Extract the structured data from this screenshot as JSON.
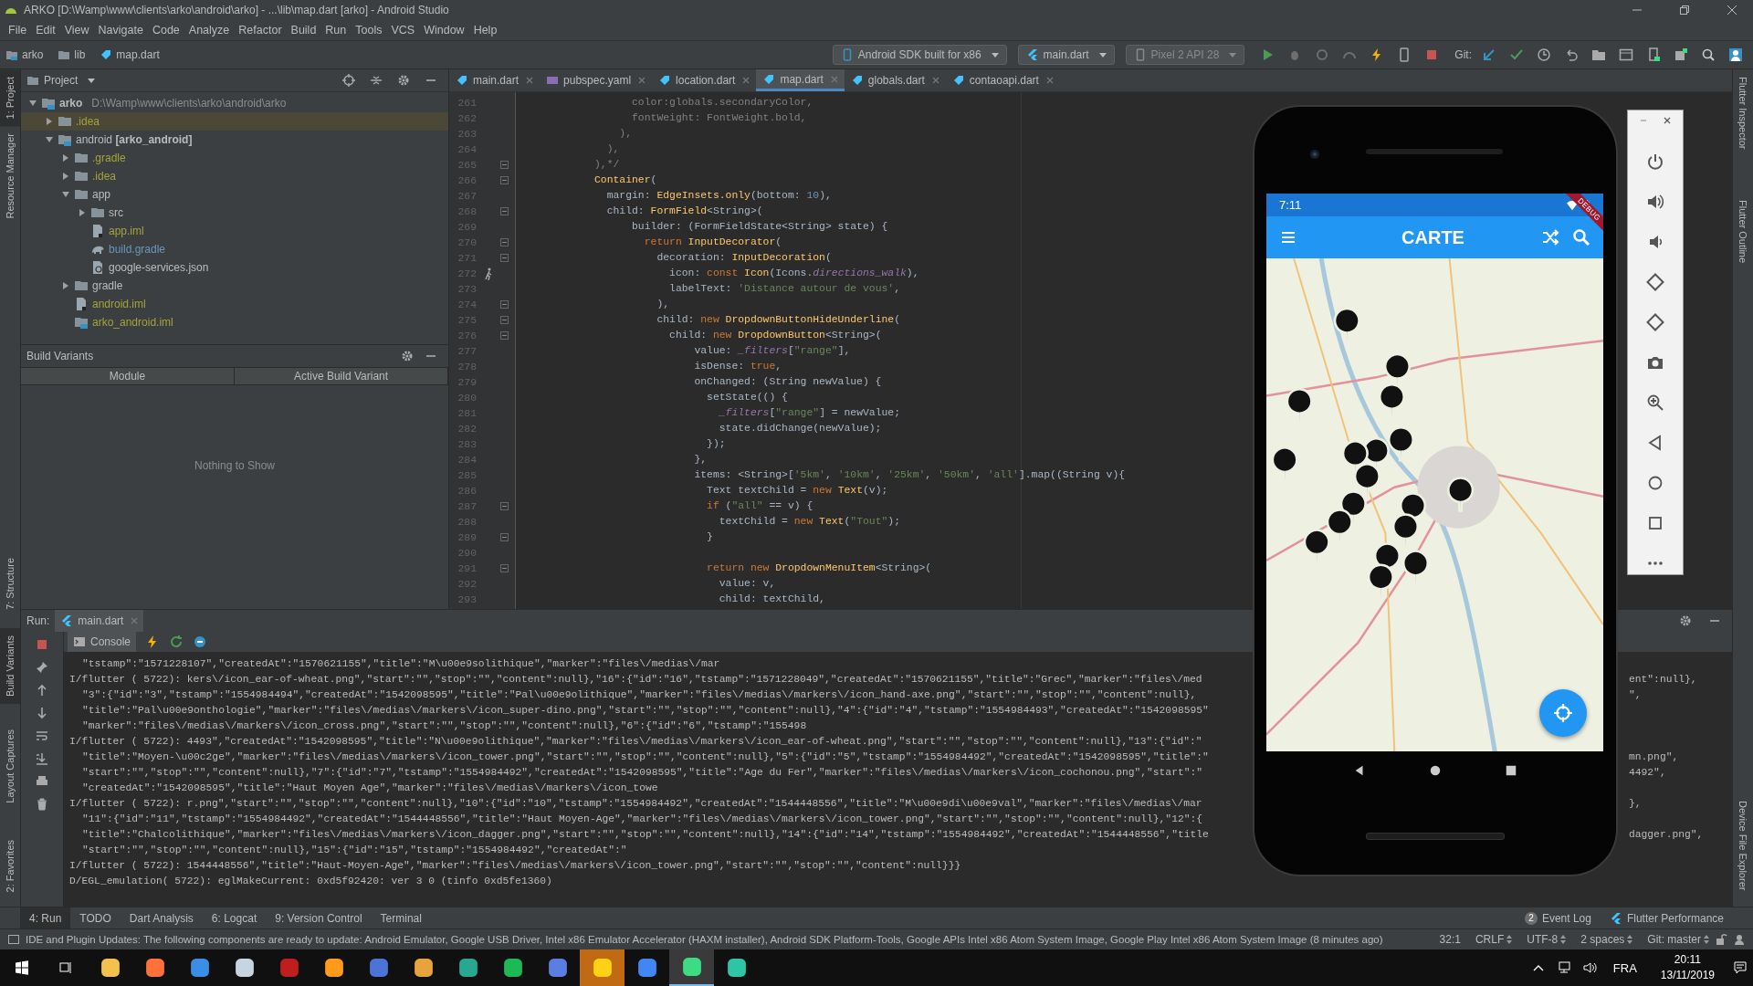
{
  "window": {
    "title": "ARKO [D:\\Wamp\\www\\clients\\arko\\android\\arko] - ...\\lib\\map.dart [arko] - Android Studio"
  },
  "menu": [
    "File",
    "Edit",
    "View",
    "Navigate",
    "Code",
    "Analyze",
    "Refactor",
    "Build",
    "Run",
    "Tools",
    "VCS",
    "Window",
    "Help"
  ],
  "breadcrumbs": [
    {
      "label": "arko",
      "kind": "module"
    },
    {
      "label": "lib",
      "kind": "folder"
    },
    {
      "label": "map.dart",
      "kind": "dart"
    }
  ],
  "toolbar": {
    "device": "Android SDK built for x86",
    "config": "main.dart",
    "emulator": "Pixel 2 API 28",
    "git_label": "Git:"
  },
  "left_stripe": [
    {
      "label": "1: Project",
      "selected": true
    },
    {
      "label": "Resource Manager",
      "selected": false
    },
    {
      "label": "7: Structure",
      "selected": false
    },
    {
      "label": "Build Variants",
      "selected": true
    },
    {
      "label": "Layout Captures",
      "selected": false
    },
    {
      "label": "2: Favorites",
      "selected": false
    }
  ],
  "right_stripe": [
    "Flutter Inspector",
    "Flutter Outline",
    "Device File Explorer"
  ],
  "project": {
    "title": "Project",
    "tree": [
      {
        "label": "**arko**",
        "path": "D:\\Wamp\\www\\clients\\arko\\android\\arko",
        "kind": "module",
        "color": "#bbbbbb",
        "selected": false,
        "expanded": true,
        "children": [
          {
            "label": ".idea",
            "kind": "folder",
            "color": "#a4a33a",
            "selected": true,
            "expanded": false
          },
          {
            "label": "android **[arko_android]**",
            "kind": "module",
            "color": "#bbbbbb",
            "selected": false,
            "expanded": true,
            "children": [
              {
                "label": ".gradle",
                "kind": "folder",
                "color": "#a4a33a",
                "selected": false,
                "expanded": false
              },
              {
                "label": ".idea",
                "kind": "folder",
                "color": "#a4a33a",
                "selected": false,
                "expanded": false
              },
              {
                "label": "app",
                "kind": "folder",
                "color": "#bbbbbb",
                "selected": false,
                "expanded": true,
                "children": [
                  {
                    "label": "src",
                    "kind": "folder",
                    "color": "#bbbbbb",
                    "selected": false,
                    "expanded": false
                  },
                  {
                    "label": "app.iml",
                    "kind": "file",
                    "color": "#a4a33a",
                    "selected": false
                  },
                  {
                    "label": "build.gradle",
                    "kind": "gradle",
                    "color": "#6897bb",
                    "selected": false
                  },
                  {
                    "label": "google-services.json",
                    "kind": "json",
                    "color": "#bbbbbb",
                    "selected": false
                  }
                ]
              },
              {
                "label": "gradle",
                "kind": "folder",
                "color": "#bbbbbb",
                "selected": false,
                "expanded": false
              },
              {
                "label": "android.iml",
                "kind": "file",
                "color": "#a4a33a",
                "selected": false
              },
              {
                "label": "arko_android.iml",
                "kind": "module",
                "color": "#a4a33a",
                "selected": false
              }
            ]
          }
        ]
      }
    ]
  },
  "build_variants": {
    "title": "Build Variants",
    "columns": [
      "Module",
      "Active Build Variant"
    ],
    "empty": "Nothing to Show"
  },
  "editor": {
    "tabs": [
      {
        "label": "main.dart",
        "kind": "dart",
        "selected": false
      },
      {
        "label": "pubspec.yaml",
        "kind": "yaml",
        "selected": false
      },
      {
        "label": "location.dart",
        "kind": "dart",
        "selected": false
      },
      {
        "label": "map.dart",
        "kind": "dart",
        "selected": true
      },
      {
        "label": "globals.dart",
        "kind": "dart",
        "selected": false
      },
      {
        "label": "contaoapi.dart",
        "kind": "dart",
        "selected": false
      }
    ],
    "lines": [
      {
        "n": "261",
        "fold": false,
        "tokens": [
          {
            "kind": "comment",
            "text": "                  color:globals.secondaryColor,"
          }
        ]
      },
      {
        "n": "262",
        "fold": false,
        "tokens": [
          {
            "kind": "comment",
            "text": "                  fontWeight: FontWeight.bold,"
          }
        ]
      },
      {
        "n": "263",
        "fold": false,
        "tokens": [
          {
            "kind": "comment",
            "text": "                ),"
          }
        ]
      },
      {
        "n": "264",
        "fold": false,
        "tokens": [
          {
            "kind": "comment",
            "text": "              ),"
          }
        ]
      },
      {
        "n": "265",
        "fold": true,
        "tokens": [
          {
            "kind": "comment",
            "text": "            ),*/"
          }
        ]
      },
      {
        "n": "266",
        "fold": true,
        "tokens": [
          {
            "kind": "class",
            "text": "            Container"
          },
          {
            "kind": "plain",
            "text": "("
          }
        ]
      },
      {
        "n": "267",
        "fold": false,
        "tokens": [
          {
            "kind": "plain",
            "text": "              margin: "
          },
          {
            "kind": "class",
            "text": "EdgeInsets.only"
          },
          {
            "kind": "plain",
            "text": "(bottom: "
          },
          {
            "kind": "number",
            "text": "10"
          },
          {
            "kind": "plain",
            "text": "),"
          }
        ]
      },
      {
        "n": "268",
        "fold": true,
        "tokens": [
          {
            "kind": "plain",
            "text": "              child: "
          },
          {
            "kind": "class",
            "text": "FormField"
          },
          {
            "kind": "plain",
            "text": "<String>("
          }
        ]
      },
      {
        "n": "269",
        "fold": false,
        "tokens": [
          {
            "kind": "plain",
            "text": "                  builder: (FormFieldState<String> state) {"
          }
        ]
      },
      {
        "n": "270",
        "fold": true,
        "tokens": [
          {
            "kind": "keyword",
            "text": "                    return "
          },
          {
            "kind": "class",
            "text": "InputDecorator"
          },
          {
            "kind": "plain",
            "text": "("
          }
        ]
      },
      {
        "n": "271",
        "fold": true,
        "tokens": [
          {
            "kind": "plain",
            "text": "                      decoration: "
          },
          {
            "kind": "class",
            "text": "InputDecoration"
          },
          {
            "kind": "plain",
            "text": "("
          }
        ]
      },
      {
        "n": "272",
        "fold": false,
        "kind": "gutter-icon",
        "tokens": [
          {
            "kind": "plain",
            "text": "                        icon: "
          },
          {
            "kind": "keyword",
            "text": "const "
          },
          {
            "kind": "class",
            "text": "Icon"
          },
          {
            "kind": "plain",
            "text": "(Icons."
          },
          {
            "kind": "field",
            "text": "directions_walk"
          },
          {
            "kind": "plain",
            "text": "),"
          }
        ]
      },
      {
        "n": "273",
        "fold": false,
        "tokens": [
          {
            "kind": "plain",
            "text": "                        labelText: "
          },
          {
            "kind": "string",
            "text": "'Distance autour de vous'"
          },
          {
            "kind": "plain",
            "text": ","
          }
        ]
      },
      {
        "n": "274",
        "fold": true,
        "tokens": [
          {
            "kind": "plain",
            "text": "                      ),"
          }
        ]
      },
      {
        "n": "275",
        "fold": true,
        "tokens": [
          {
            "kind": "plain",
            "text": "                      child: "
          },
          {
            "kind": "keyword",
            "text": "new "
          },
          {
            "kind": "class",
            "text": "DropdownButtonHideUnderline"
          },
          {
            "kind": "plain",
            "text": "("
          }
        ]
      },
      {
        "n": "276",
        "fold": true,
        "tokens": [
          {
            "kind": "plain",
            "text": "                        child: "
          },
          {
            "kind": "keyword",
            "text": "new "
          },
          {
            "kind": "class",
            "text": "DropdownButton"
          },
          {
            "kind": "plain",
            "text": "<String>("
          }
        ]
      },
      {
        "n": "277",
        "fold": false,
        "tokens": [
          {
            "kind": "plain",
            "text": "                            value: "
          },
          {
            "kind": "field",
            "text": "_filters"
          },
          {
            "kind": "plain",
            "text": "["
          },
          {
            "kind": "string",
            "text": "\"range\""
          },
          {
            "kind": "plain",
            "text": "],"
          }
        ]
      },
      {
        "n": "278",
        "fold": false,
        "tokens": [
          {
            "kind": "plain",
            "text": "                            isDense: "
          },
          {
            "kind": "keyword",
            "text": "true"
          },
          {
            "kind": "plain",
            "text": ","
          }
        ]
      },
      {
        "n": "279",
        "fold": false,
        "tokens": [
          {
            "kind": "plain",
            "text": "                            onChanged: (String newValue) {"
          }
        ]
      },
      {
        "n": "280",
        "fold": false,
        "tokens": [
          {
            "kind": "plain",
            "text": "                              setState(() {"
          }
        ]
      },
      {
        "n": "281",
        "fold": false,
        "tokens": [
          {
            "kind": "field",
            "text": "                                _filters"
          },
          {
            "kind": "plain",
            "text": "["
          },
          {
            "kind": "string",
            "text": "\"range\""
          },
          {
            "kind": "plain",
            "text": "] = newValue;"
          }
        ]
      },
      {
        "n": "282",
        "fold": false,
        "tokens": [
          {
            "kind": "plain",
            "text": "                                state.didChange(newValue);"
          }
        ]
      },
      {
        "n": "283",
        "fold": false,
        "tokens": [
          {
            "kind": "plain",
            "text": "                              });"
          }
        ]
      },
      {
        "n": "284",
        "fold": false,
        "tokens": [
          {
            "kind": "plain",
            "text": "                            },"
          }
        ]
      },
      {
        "n": "285",
        "fold": false,
        "tokens": [
          {
            "kind": "plain",
            "text": "                            items: <String>["
          },
          {
            "kind": "string",
            "text": "'5km'"
          },
          {
            "kind": "plain",
            "text": ", "
          },
          {
            "kind": "string",
            "text": "'10km'"
          },
          {
            "kind": "plain",
            "text": ", "
          },
          {
            "kind": "string",
            "text": "'25km'"
          },
          {
            "kind": "plain",
            "text": ", "
          },
          {
            "kind": "string",
            "text": "'50km'"
          },
          {
            "kind": "plain",
            "text": ", "
          },
          {
            "kind": "string",
            "text": "'all'"
          },
          {
            "kind": "plain",
            "text": "].map((String v){"
          }
        ]
      },
      {
        "n": "286",
        "fold": false,
        "tokens": [
          {
            "kind": "plain",
            "text": "                              Text textChild = "
          },
          {
            "kind": "keyword",
            "text": "new "
          },
          {
            "kind": "class",
            "text": "Text"
          },
          {
            "kind": "plain",
            "text": "(v);"
          }
        ]
      },
      {
        "n": "287",
        "fold": true,
        "tokens": [
          {
            "kind": "keyword",
            "text": "                              if "
          },
          {
            "kind": "plain",
            "text": "("
          },
          {
            "kind": "string",
            "text": "\"all\""
          },
          {
            "kind": "plain",
            "text": " == v) {"
          }
        ]
      },
      {
        "n": "288",
        "fold": false,
        "tokens": [
          {
            "kind": "plain",
            "text": "                                textChild = "
          },
          {
            "kind": "keyword",
            "text": "new "
          },
          {
            "kind": "class",
            "text": "Text"
          },
          {
            "kind": "plain",
            "text": "("
          },
          {
            "kind": "string",
            "text": "\"Tout\""
          },
          {
            "kind": "plain",
            "text": ");"
          }
        ]
      },
      {
        "n": "289",
        "fold": true,
        "tokens": [
          {
            "kind": "plain",
            "text": "                              }"
          }
        ]
      },
      {
        "n": "290",
        "fold": false
      },
      {
        "n": "291",
        "fold": true,
        "tokens": [
          {
            "kind": "keyword",
            "text": "                              return new "
          },
          {
            "kind": "class",
            "text": "DropdownMenuItem"
          },
          {
            "kind": "plain",
            "text": "<String>("
          }
        ]
      },
      {
        "n": "292",
        "fold": false,
        "tokens": [
          {
            "kind": "plain",
            "text": "                                value: v,"
          }
        ]
      },
      {
        "n": "293",
        "fold": false,
        "tokens": [
          {
            "kind": "plain",
            "text": "                                child: textChild,"
          }
        ]
      }
    ]
  },
  "phone": {
    "time": "7:11",
    "debug_banner": "DEBUG",
    "app_title": "CARTE"
  },
  "run": {
    "label": "Run:",
    "tab": "main.dart",
    "console_tab": "Console",
    "lines": [
      {
        "continuation": true,
        "text": "\"tstamp\":\"1571228107\",\"createdAt\":\"1570621155\",\"title\":\"M\\u00e9solithique\",\"marker\":\"files\\/medias\\/mar"
      },
      {
        "continuation": false,
        "text": "I/flutter ( 5722): kers\\/icon_ear-of-wheat.png\",\"start\":\"\",\"stop\":\"\",\"content\":null},\"16\":{\"id\":\"16\",\"tstamp\":\"1571228049\",\"createdAt\":\"1570621155\",\"title\":\"Grec\",\"marker\":\"files\\/med",
        "tail": "ent\":null},"
      },
      {
        "continuation": true,
        "text": "\"3\":{\"id\":\"3\",\"tstamp\":\"1554984494\",\"createdAt\":\"1542098595\",\"title\":\"Pal\\u00e9olithique\",\"marker\":\"files\\/medias\\/markers\\/icon_hand-axe.png\",\"start\":\"\",\"stop\":\"\",\"content\":null},",
        "tail": "\","
      },
      {
        "continuation": true,
        "text": "\"title\":\"Pal\\u00e9onthologie\",\"marker\":\"files\\/medias\\/markers\\/icon_super-dino.png\",\"start\":\"\",\"stop\":\"\",\"content\":null},\"4\":{\"id\":\"4\",\"tstamp\":\"1554984493\",\"createdAt\":\"1542098595\""
      },
      {
        "continuation": true,
        "text": "\"marker\":\"files\\/medias\\/markers\\/icon_cross.png\",\"start\":\"\",\"stop\":\"\",\"content\":null},\"6\":{\"id\":\"6\",\"tstamp\":\"155498"
      },
      {
        "continuation": false,
        "text": "I/flutter ( 5722): 4493\",\"createdAt\":\"1542098595\",\"title\":\"N\\u00e9olithique\",\"marker\":\"files\\/medias\\/markers\\/icon_ear-of-wheat.png\",\"start\":\"\",\"stop\":\"\",\"content\":null},\"13\":{\"id\":\""
      },
      {
        "continuation": true,
        "text": "\"title\":\"Moyen-\\u00c2ge\",\"marker\":\"files\\/medias\\/markers\\/icon_tower.png\",\"start\":\"\",\"stop\":\"\",\"content\":null},\"5\":{\"id\":\"5\",\"tstamp\":\"1554984492\",\"createdAt\":\"1542098595\",\"title\":\"",
        "tail": "mn.png\","
      },
      {
        "continuation": true,
        "text": "\"start\":\"\",\"stop\":\"\",\"content\":null},\"7\":{\"id\":\"7\",\"tstamp\":\"1554984492\",\"createdAt\":\"1542098595\",\"title\":\"Age du Fer\",\"marker\":\"files\\/medias\\/markers\\/icon_cochonou.png\",\"start\":\"",
        "tail": "4492\","
      },
      {
        "continuation": true,
        "text": "\"createdAt\":\"1542098595\",\"title\":\"Haut Moyen Age\",\"marker\":\"files\\/medias\\/markers\\/icon_towe"
      },
      {
        "continuation": false,
        "text": "I/flutter ( 5722): r.png\",\"start\":\"\",\"stop\":\"\",\"content\":null},\"10\":{\"id\":\"10\",\"tstamp\":\"1554984492\",\"createdAt\":\"1544448556\",\"title\":\"M\\u00e9di\\u00e9val\",\"marker\":\"files\\/medias\\/mar",
        "tail": "},"
      },
      {
        "continuation": true,
        "text": "\"11\":{\"id\":\"11\",\"tstamp\":\"1554984492\",\"createdAt\":\"1544448556\",\"title\":\"Haut Moyen-Age\",\"marker\":\"files\\/medias\\/markers\\/icon_tower.png\",\"start\":\"\",\"stop\":\"\",\"content\":null},\"12\":{"
      },
      {
        "continuation": true,
        "text": "\"title\":\"Chalcolithique\",\"marker\":\"files\\/medias\\/markers\\/icon_dagger.png\",\"start\":\"\",\"stop\":\"\",\"content\":null},\"14\":{\"id\":\"14\",\"tstamp\":\"1554984492\",\"createdAt\":\"1544448556\",\"title",
        "tail": "dagger.png\","
      },
      {
        "continuation": true,
        "text": "\"start\":\"\",\"stop\":\"\",\"content\":null},\"15\":{\"id\":\"15\",\"tstamp\":\"1554984492\",\"createdAt\":\""
      },
      {
        "continuation": false,
        "text": "I/flutter ( 5722): 1544448556\",\"title\":\"Haut-Moyen-Age\",\"marker\":\"files\\/medias\\/markers\\/icon_tower.png\",\"start\":\"\",\"stop\":\"\",\"content\":null}}}"
      },
      {
        "continuation": false,
        "text": "D/EGL_emulation( 5722): eglMakeCurrent: 0xd5f92420: ver 3 0 (tinfo 0xd5fe1360)"
      }
    ]
  },
  "tool_tabs": [
    {
      "label": "4: Run",
      "selected": true
    },
    {
      "label": "TODO",
      "selected": false
    },
    {
      "label": "Dart Analysis",
      "selected": false
    },
    {
      "label": "6: Logcat",
      "selected": false
    },
    {
      "label": "9: Version Control",
      "selected": false
    },
    {
      "label": "Terminal",
      "selected": false
    }
  ],
  "right_tool_tabs": [
    {
      "label": "Event Log",
      "badge": "2"
    },
    {
      "label": "Flutter Performance"
    }
  ],
  "status_bar": {
    "message": "IDE and Plugin Updates: The following components are ready to update: Android Emulator, Google USB Driver, Intel x86 Emulator Accelerator (HAXM installer), Android SDK Platform-Tools, Google APIs Intel x86 Atom System Image, Google Play Intel x86 Atom System Image (8 minutes ago)",
    "items": [
      {
        "label": "32:1",
        "dropdown": false
      },
      {
        "label": "CRLF",
        "dropdown": true
      },
      {
        "label": "UTF-8",
        "dropdown": true
      },
      {
        "label": "2 spaces",
        "dropdown": true
      },
      {
        "label": "Git: master",
        "dropdown": true
      }
    ]
  },
  "taskbar": {
    "apps": [
      {
        "color": "#f2c14e",
        "kind": "normal"
      },
      {
        "color": "#ff7139",
        "kind": "normal"
      },
      {
        "color": "#3a8ee6",
        "kind": "normal"
      },
      {
        "color": "#c7d5e0",
        "kind": "normal"
      },
      {
        "color": "#bf1e1e",
        "kind": "normal"
      },
      {
        "color": "#ff9a1a",
        "kind": "normal"
      },
      {
        "color": "#4d73d9",
        "kind": "normal"
      },
      {
        "color": "#e8a33d",
        "kind": "normal"
      },
      {
        "color": "#27a88f",
        "kind": "normal"
      },
      {
        "color": "#1db954",
        "kind": "normal"
      },
      {
        "color": "#5b7fe0",
        "kind": "normal"
      },
      {
        "color": "#fcd116",
        "kind": "attention"
      },
      {
        "color": "#4285f4",
        "kind": "normal"
      },
      {
        "color": "#3ddc84",
        "kind": "active"
      },
      {
        "color": "#2ec4a6",
        "kind": "normal"
      }
    ],
    "language": "FRA",
    "time": "20:11",
    "date": "13/11/2019"
  }
}
